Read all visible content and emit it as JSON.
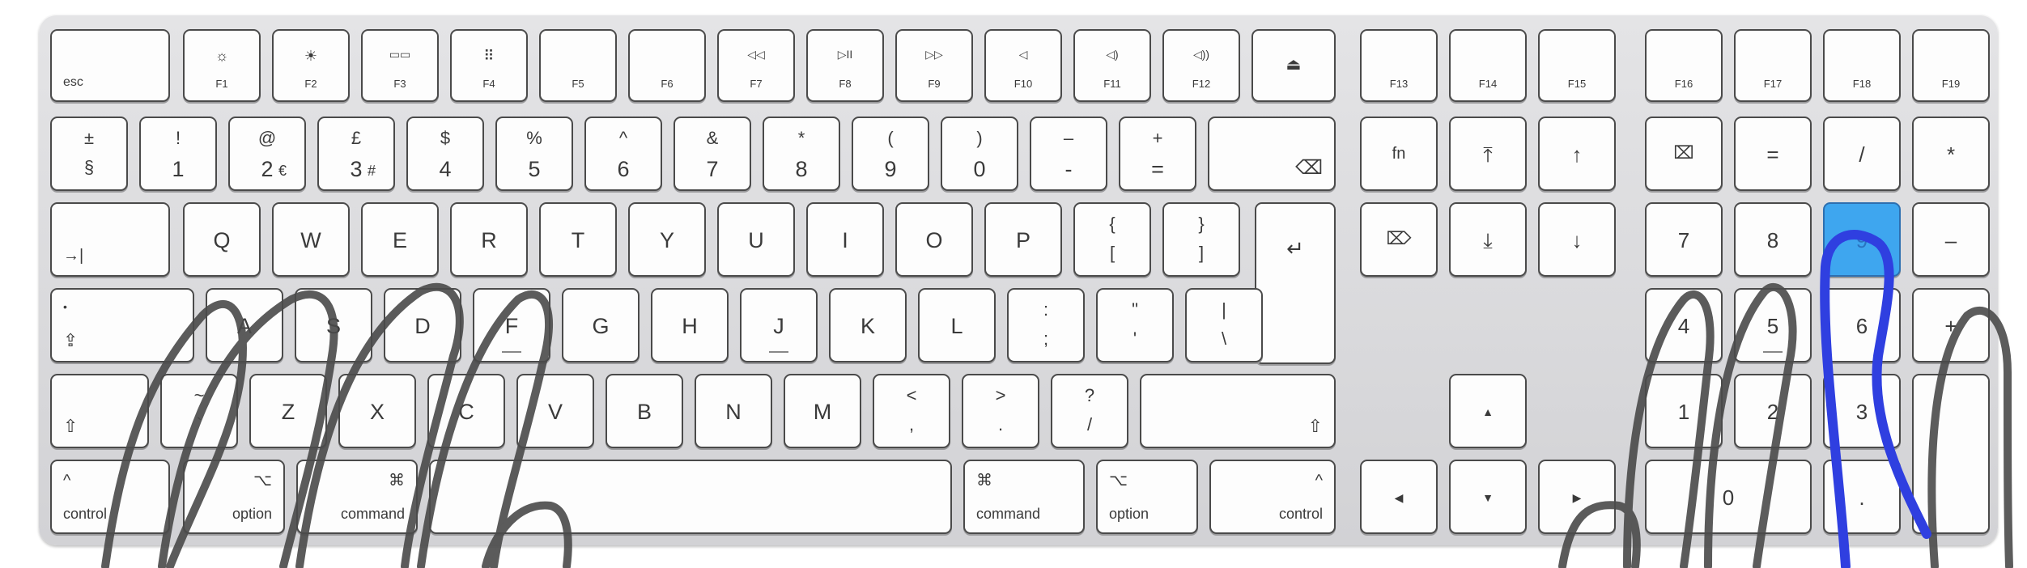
{
  "keyboard": {
    "row1": {
      "esc": "esc",
      "f_keys": [
        "F1",
        "F2",
        "F3",
        "F4",
        "F5",
        "F6",
        "F7",
        "F8",
        "F9",
        "F10",
        "F11",
        "F12"
      ],
      "f_icons": [
        "☼",
        "☀",
        "▭▭",
        "⠿",
        "",
        "",
        "◁◁",
        "▷II",
        "▷▷",
        "◁",
        "◁)",
        "◁))"
      ],
      "eject": "⏏",
      "ext_keys": [
        "F13",
        "F14",
        "F15"
      ],
      "keypad_f": [
        "F16",
        "F17",
        "F18",
        "F19"
      ]
    },
    "row2": {
      "top": [
        "±",
        "!",
        "@",
        "£",
        "$",
        "%",
        "^",
        "&",
        "*",
        "(",
        ")",
        "–",
        "+"
      ],
      "bottom": [
        "§",
        "1",
        "2",
        "3",
        "4",
        "5",
        "6",
        "7",
        "8",
        "9",
        "0",
        "-",
        "="
      ],
      "euro": "€",
      "hash": "#",
      "delete_icon": "⌫",
      "fn": "fn",
      "home": "⤒",
      "pgup": "↑",
      "clear": "⌧",
      "kp_equals": "=",
      "kp_slash": "/",
      "kp_star": "*"
    },
    "row3": {
      "tab": "→|",
      "letters": [
        "Q",
        "W",
        "E",
        "R",
        "T",
        "Y",
        "U",
        "I",
        "O",
        "P"
      ],
      "brace_top": "{",
      "brace_bot": "[",
      "close_top": "}",
      "close_bot": "]",
      "return": "↵",
      "fwd_delete": "⌦",
      "end": "⤓",
      "pgdown": "↓",
      "kp7": "7",
      "kp8": "8",
      "kp9": "9",
      "kp_minus": "–"
    },
    "row4": {
      "caps_dot": "•",
      "caps_icon": "⇪",
      "letters": [
        "A",
        "S",
        "D",
        "F",
        "G",
        "H",
        "J",
        "K",
        "L"
      ],
      "semicolon_top": ":",
      "semicolon_bot": ";",
      "quote_top": "\"",
      "quote_bot": "'",
      "pipe_top": "|",
      "pipe_bot": "\\",
      "kp4": "4",
      "kp5": "5",
      "kp6": "6",
      "kp_plus": "+"
    },
    "row5": {
      "shift": "⇧",
      "grave_top": "~",
      "grave_bot": "`",
      "letters": [
        "Z",
        "X",
        "C",
        "V",
        "B",
        "N",
        "M"
      ],
      "lt_top": "<",
      "lt_bot": ",",
      "gt_top": ">",
      "gt_bot": ".",
      "q_top": "?",
      "q_bot": "/",
      "right_shift": "⇧",
      "up_arrow": "▲",
      "kp1": "1",
      "kp2": "2",
      "kp3": "3"
    },
    "row6": {
      "control_icon": "^",
      "control": "control",
      "option_icon": "⌥",
      "option": "option",
      "command_icon": "⌘",
      "command": "command",
      "left_arrow": "◀",
      "down_arrow": "▼",
      "right_arrow": "▶",
      "kp0": "0",
      "kp_dot": "."
    }
  },
  "colors": {
    "key_face": "#fdfdfd",
    "frame": "#d8d8db",
    "highlight": "#3ea6ef",
    "scribble_gray": "#4a4a4a",
    "scribble_blue": "#2f3fe0"
  }
}
